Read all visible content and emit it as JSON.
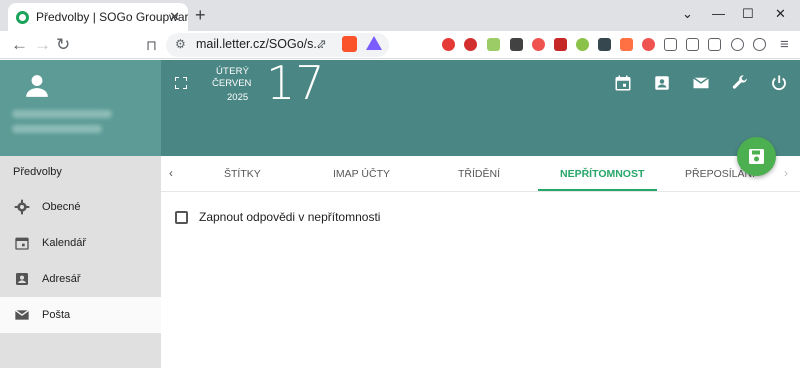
{
  "browser": {
    "tab_title": "Předvolby | SOGo Groupware",
    "tab_close": "✕",
    "new_tab": "+",
    "url": "mail.letter.cz/SOGo/s...",
    "window_controls": [
      "⌄",
      "—",
      "☐",
      "✕"
    ]
  },
  "header": {
    "date_weekday": "ÚTERÝ",
    "date_month": "ČERVEN",
    "date_year": "2025",
    "date_day": "17"
  },
  "sidebar": {
    "title": "Předvolby",
    "items": [
      {
        "label": "Obecné",
        "icon": "gear-icon"
      },
      {
        "label": "Kalendář",
        "icon": "calendar-icon"
      },
      {
        "label": "Adresář",
        "icon": "contacts-icon"
      },
      {
        "label": "Pošta",
        "icon": "mail-icon"
      }
    ]
  },
  "tabs": [
    "ŠTÍTKY",
    "IMAP ÚČTY",
    "TŘÍDĚNÍ",
    "NEPŘÍTOMNOST",
    "PŘEPOSÍLÁNÍ"
  ],
  "active_tab": "NEPŘÍTOMNOST",
  "form": {
    "checkbox_label": "Zapnout odpovědi v nepřítomnosti"
  },
  "colors": {
    "accent": "#26a668",
    "header": "#4a8683",
    "sidebar_header": "#5c9b96"
  }
}
